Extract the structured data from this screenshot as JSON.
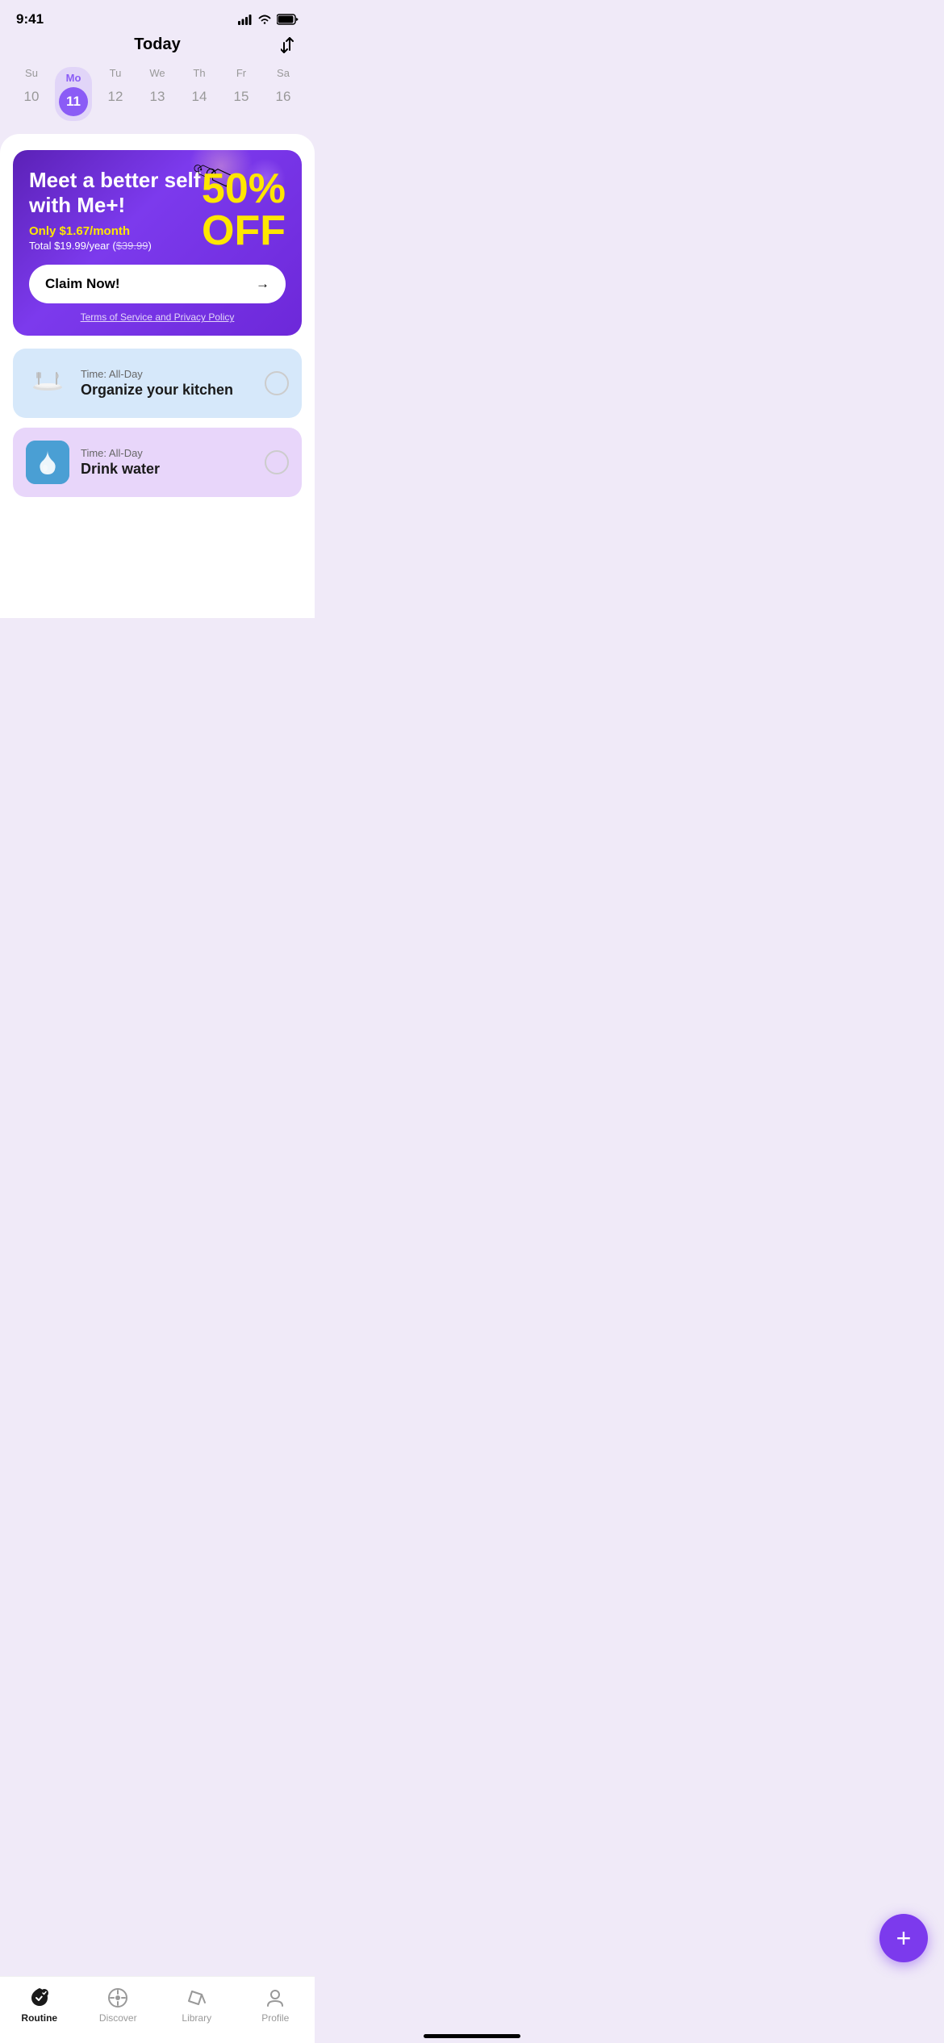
{
  "statusBar": {
    "time": "9:41"
  },
  "header": {
    "title": "Today"
  },
  "calendar": {
    "days": [
      {
        "name": "Su",
        "num": "10",
        "active": false
      },
      {
        "name": "Mo",
        "num": "11",
        "active": true
      },
      {
        "name": "Tu",
        "num": "12",
        "active": false
      },
      {
        "name": "We",
        "num": "13",
        "active": false
      },
      {
        "name": "Th",
        "num": "14",
        "active": false
      },
      {
        "name": "Fr",
        "num": "15",
        "active": false
      },
      {
        "name": "Sa",
        "num": "16",
        "active": false
      }
    ]
  },
  "promo": {
    "headline": "Meet a better self with Me+!",
    "price": "Only $1.67/month",
    "total": "Total $19.99/year ($39.99)",
    "discount": "50%",
    "discountLine2": "OFF",
    "claimButton": "Claim Now!",
    "termsText": "Terms of Service and Privacy Policy"
  },
  "tasks": [
    {
      "id": "kitchen",
      "time": "Time: All-Day",
      "name": "Organize your kitchen",
      "bgClass": "blue-bg",
      "iconType": "kitchen"
    },
    {
      "id": "water",
      "time": "Time: All-Day",
      "name": "Drink water",
      "bgClass": "purple-bg",
      "iconType": "water"
    }
  ],
  "tabBar": {
    "tabs": [
      {
        "id": "routine",
        "label": "Routine",
        "active": true
      },
      {
        "id": "discover",
        "label": "Discover",
        "active": false
      },
      {
        "id": "library",
        "label": "Library",
        "active": false
      },
      {
        "id": "profile",
        "label": "Profile",
        "active": false
      }
    ]
  }
}
